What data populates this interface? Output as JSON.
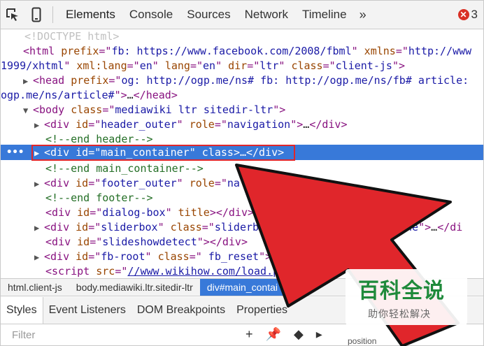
{
  "toolbar": {
    "tabs": [
      "Elements",
      "Console",
      "Sources",
      "Network",
      "Timeline"
    ],
    "more": "»",
    "error_count": "3"
  },
  "dom": {
    "line1": "<!DOCTYPE html>",
    "l2_a": "<html ",
    "l2_b": "prefix",
    "l2_c": "=\"",
    "l2_d": "fb: https://www.facebook.com/2008/fbml",
    "l2_e": "\" ",
    "l2_f": "xmlns",
    "l2_g": "=\"",
    "l2_h": "http://www",
    "l3_a": "1999/xhtml",
    "l3_b": "\" ",
    "l3_c": "xml:lang",
    "l3_d": "=\"",
    "l3_e": "en",
    "l3_f": "\" ",
    "l3_g": "lang",
    "l3_h": "=\"",
    "l3_i": "en",
    "l3_j": "\" ",
    "l3_k": "dir",
    "l3_l": "=\"",
    "l3_m": "ltr",
    "l3_n": "\" ",
    "l3_o": "class",
    "l3_p": "=\"",
    "l3_q": "client-js",
    "l3_r": "\">",
    "l4_a": "<head ",
    "l4_b": "prefix",
    "l4_c": "=\"",
    "l4_d": "og: http://ogp.me/ns# fb: http://ogp.me/ns/fb# article:",
    "l5_a": "ogp.me/ns/article#",
    "l5_b": "\">",
    "l5_c": "…",
    "l5_d": "</head>",
    "l6_a": "<body ",
    "l6_b": "class",
    "l6_c": "=\"",
    "l6_d": "mediawiki ltr  sitedir-ltr",
    "l6_e": "\">",
    "l7_a": "<div ",
    "l7_b": "id",
    "l7_c": "=\"",
    "l7_d": "header_outer",
    "l7_e": "\" ",
    "l7_f": "role",
    "l7_g": "=\"",
    "l7_h": "navigation",
    "l7_i": "\">",
    "l7_j": "…",
    "l7_k": "</div>",
    "l8": "<!--end header-->",
    "sel_dots": "•••",
    "l9_a": "<div ",
    "l9_b": "id",
    "l9_c": "=\"",
    "l9_d": "main_container",
    "l9_e": "\" ",
    "l9_f": "class",
    "l9_g": ">",
    "l9_h": "…",
    "l9_i": "</div>",
    "l10": "<!--end main_container-->",
    "l11_a": "<div ",
    "l11_b": "id",
    "l11_c": "=\"",
    "l11_d": "footer_outer",
    "l11_e": "\" ",
    "l11_f": "role",
    "l11_g": "=\"",
    "l11_h": "na",
    "l12": "<!--end footer-->",
    "l13_a": "<div ",
    "l13_b": "id",
    "l13_c": "=\"",
    "l13_d": "dialog-box",
    "l13_e": "\" ",
    "l13_f": "title",
    "l13_g": ">",
    "l13_h": "</div>",
    "l14_a": "<div ",
    "l14_b": "id",
    "l14_c": "=\"",
    "l14_d": "sliderbox",
    "l14_e": "\" ",
    "l14_f": "class",
    "l14_g": "=\"",
    "l14_h": "sliderbox",
    "l14_i": "one",
    "l14_j": "\">",
    "l14_k": "…",
    "l14_l": "</di",
    "l15_a": "<div ",
    "l15_b": "id",
    "l15_c": "=\"",
    "l15_d": "slideshowdetect",
    "l15_e": "\">",
    "l15_f": "</div>",
    "l16_a": "<div ",
    "l16_b": "id",
    "l16_c": "=\"",
    "l16_d": "fb-root",
    "l16_e": "\" ",
    "l16_f": "class",
    "l16_g": "=\"",
    "l16_h": " fb_reset",
    "l16_i": "\">",
    "l16_j": "…",
    "l16_k": "</d",
    "l17_a": "<script ",
    "l17_b": "src",
    "l17_c": "=\"",
    "l17_d": "//www.wikihow.com/load.php?"
  },
  "breadcrumbs": [
    "html.client-js",
    "body.mediawiki.ltr.sitedir-ltr",
    "div#main_contai"
  ],
  "subtabs": [
    "Styles",
    "Event Listeners",
    "DOM Breakpoints",
    "Properties"
  ],
  "filter_placeholder": "Filter",
  "filter_icons": [
    "+",
    "📌",
    "◆",
    "▸"
  ],
  "metrics_label": "position",
  "watermark": {
    "title": "百科全说",
    "subtitle": "助你轻松解决"
  },
  "colors": {
    "accent": "#3879d9",
    "annotation": "#e0262b",
    "watermark": "#1f8a3b"
  }
}
